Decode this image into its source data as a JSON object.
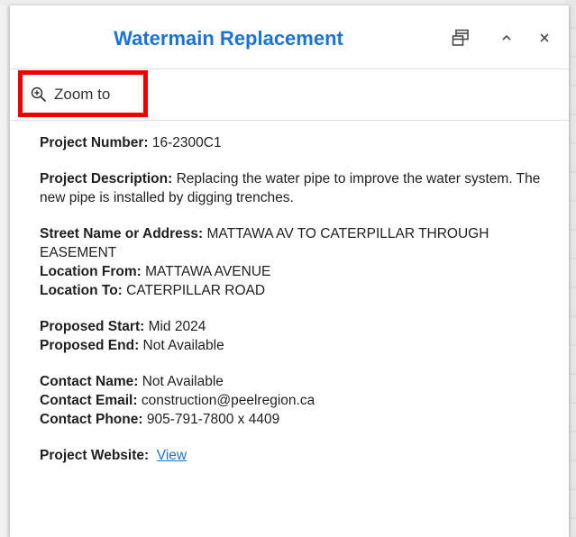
{
  "popup": {
    "title": "Watermain Replacement",
    "dock_icon": "dock-icon",
    "collapse_icon": "chevron-up-icon",
    "close_icon": "close-icon"
  },
  "actions": {
    "zoom_label": "Zoom to",
    "zoom_icon": "zoom-in-icon"
  },
  "fields": {
    "project_number_label": "Project Number:",
    "project_number_value": "16-2300C1",
    "project_description_label": "Project Description:",
    "project_description_value": "Replacing the water pipe to improve the water system. The new pipe is installed by digging trenches.",
    "street_label": "Street Name or Address:",
    "street_value": "MATTAWA AV TO CATERPILLAR THROUGH EASEMENT",
    "location_from_label": "Location From:",
    "location_from_value": "MATTAWA AVENUE",
    "location_to_label": "Location To:",
    "location_to_value": "CATERPILLAR ROAD",
    "proposed_start_label": "Proposed Start:",
    "proposed_start_value": "Mid 2024",
    "proposed_end_label": "Proposed End:",
    "proposed_end_value": "Not Available",
    "contact_name_label": "Contact Name:",
    "contact_name_value": "Not Available",
    "contact_email_label": "Contact Email:",
    "contact_email_value": "construction@peelregion.ca",
    "contact_phone_label": "Contact Phone:",
    "contact_phone_value": "905-791-7800 x 4409",
    "project_website_label": "Project Website:",
    "project_website_link": "View"
  },
  "colors": {
    "title": "#1a73d8",
    "link": "#1a73d8",
    "highlight": "#ee0000"
  }
}
